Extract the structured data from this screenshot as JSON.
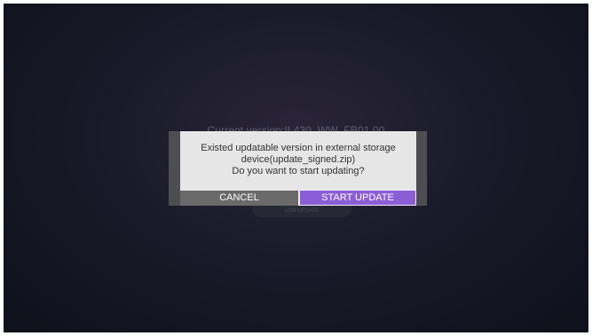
{
  "background": {
    "current_version": "Current version:IL430_WW_FB01.00",
    "usb_update_label": "USB UPDATE"
  },
  "dialog": {
    "message_lines": [
      "Existed updatable version in external storage",
      "device(update_signed.zip)",
      "Do you want to start updating?"
    ],
    "cancel_label": "CANCEL",
    "start_label": "START UPDATE"
  },
  "colors": {
    "accent": "#8c5ed6",
    "cancel_bg": "#6a6a6a",
    "dialog_bg": "#e6e6e6"
  }
}
